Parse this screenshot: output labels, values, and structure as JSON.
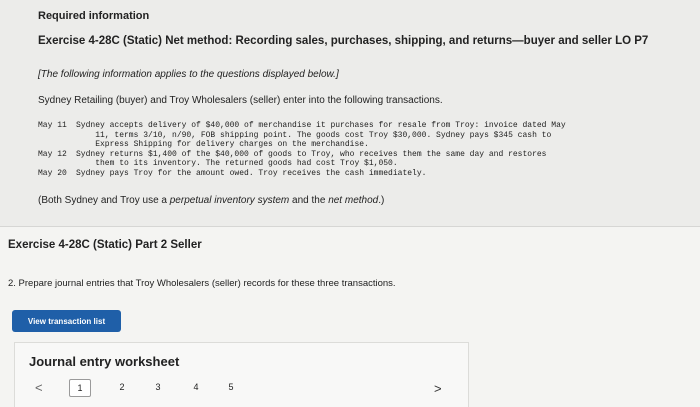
{
  "header": {
    "required": "Required information",
    "exercise_title": "Exercise 4-28C (Static) Net method: Recording sales, purchases, shipping, and returns—buyer and seller LO P7",
    "note": "[The following information applies to the questions displayed below.]",
    "intro": "Sydney Retailing (buyer) and Troy Wholesalers (seller) enter into the following transactions."
  },
  "transactions": [
    {
      "date": "May 11",
      "lines": [
        "Sydney accepts delivery of $40,000 of merchandise it purchases for resale from Troy: invoice dated May",
        "    11, terms 3/10, n/90, FOB shipping point. The goods cost Troy $30,000. Sydney pays $345 cash to",
        "    Express Shipping for delivery charges on the merchandise."
      ]
    },
    {
      "date": "May 12",
      "lines": [
        "Sydney returns $1,400 of the $40,000 of goods to Troy, who receives them the same day and restores",
        "    them to its inventory. The returned goods had cost Troy $1,050."
      ]
    },
    {
      "date": "May 20",
      "lines": [
        "Sydney pays Troy for the amount owed. Troy receives the cash immediately."
      ]
    }
  ],
  "both_note": {
    "prefix": "(Both Sydney and Troy use a ",
    "perpetual": "perpetual inventory system",
    "middle": " and the ",
    "net": "net method",
    "suffix": ".)"
  },
  "part": {
    "title": "Exercise 4-28C (Static) Part 2 Seller",
    "instruction": "2. Prepare journal entries that Troy Wholesalers (seller) records for these three transactions.",
    "view_button": "View transaction list"
  },
  "worksheet": {
    "title": "Journal entry worksheet",
    "prev_glyph": "<",
    "next_glyph": ">",
    "pages": [
      "1",
      "2",
      "3",
      "4",
      "5"
    ],
    "active_page": "1"
  },
  "colors": {
    "button_blue": "#1f5fa8",
    "panel_gray": "#ececea"
  }
}
